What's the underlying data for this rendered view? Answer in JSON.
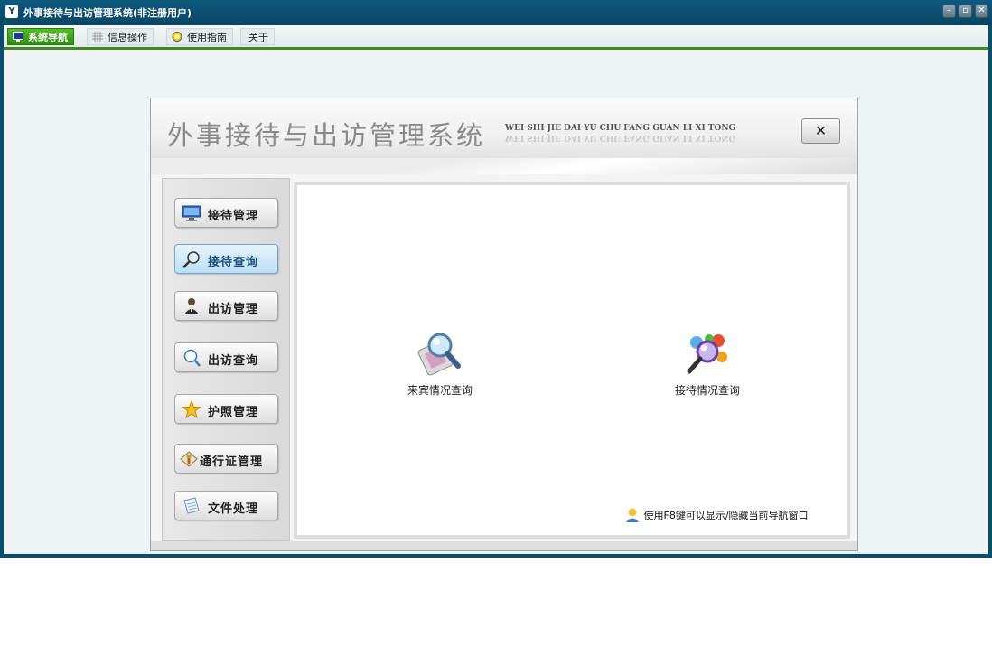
{
  "window": {
    "title": "外事接待与出访管理系统(非注册用户)",
    "controls": {
      "minimize": "–",
      "restore": "▫",
      "close": "✕"
    }
  },
  "menubar": {
    "items": [
      {
        "label": "系统导航",
        "icon": "monitor-icon",
        "active": true
      },
      {
        "label": "信息操作",
        "icon": "grid-icon",
        "active": false
      },
      {
        "label": "使用指南",
        "icon": "help-circle-icon",
        "active": false
      },
      {
        "label": "关于",
        "icon": "",
        "active": false
      }
    ]
  },
  "panel": {
    "title": "外事接待与出访管理系统",
    "subtitle": "WEI SHI JIE DAI YU CHU FANG GUAN  LI  XI  TONG",
    "close_label": "✕"
  },
  "sidebar": {
    "items": [
      {
        "label": "接待管理",
        "icon": "monitor-icon",
        "selected": false
      },
      {
        "label": "接待查询",
        "icon": "magnifier-icon",
        "selected": true
      },
      {
        "label": "出访管理",
        "icon": "person-icon",
        "selected": false
      },
      {
        "label": "出访查询",
        "icon": "search-icon",
        "selected": false
      },
      {
        "label": "护照管理",
        "icon": "star-icon",
        "selected": false
      },
      {
        "label": "通行证管理",
        "icon": "pass-icon",
        "selected": false
      },
      {
        "label": "文件处理",
        "icon": "document-icon",
        "selected": false
      }
    ]
  },
  "main": {
    "features": [
      {
        "label": "来宾情况查询",
        "icon": "guest-search-icon"
      },
      {
        "label": "接待情况查询",
        "icon": "reception-search-icon"
      }
    ],
    "hint": "使用F8键可以显示/隐藏当前导航窗口"
  },
  "colors": {
    "titlebar": "#0b4d6e",
    "menu_active": "#3a9e18",
    "nav_selected": "#bcdff6"
  }
}
